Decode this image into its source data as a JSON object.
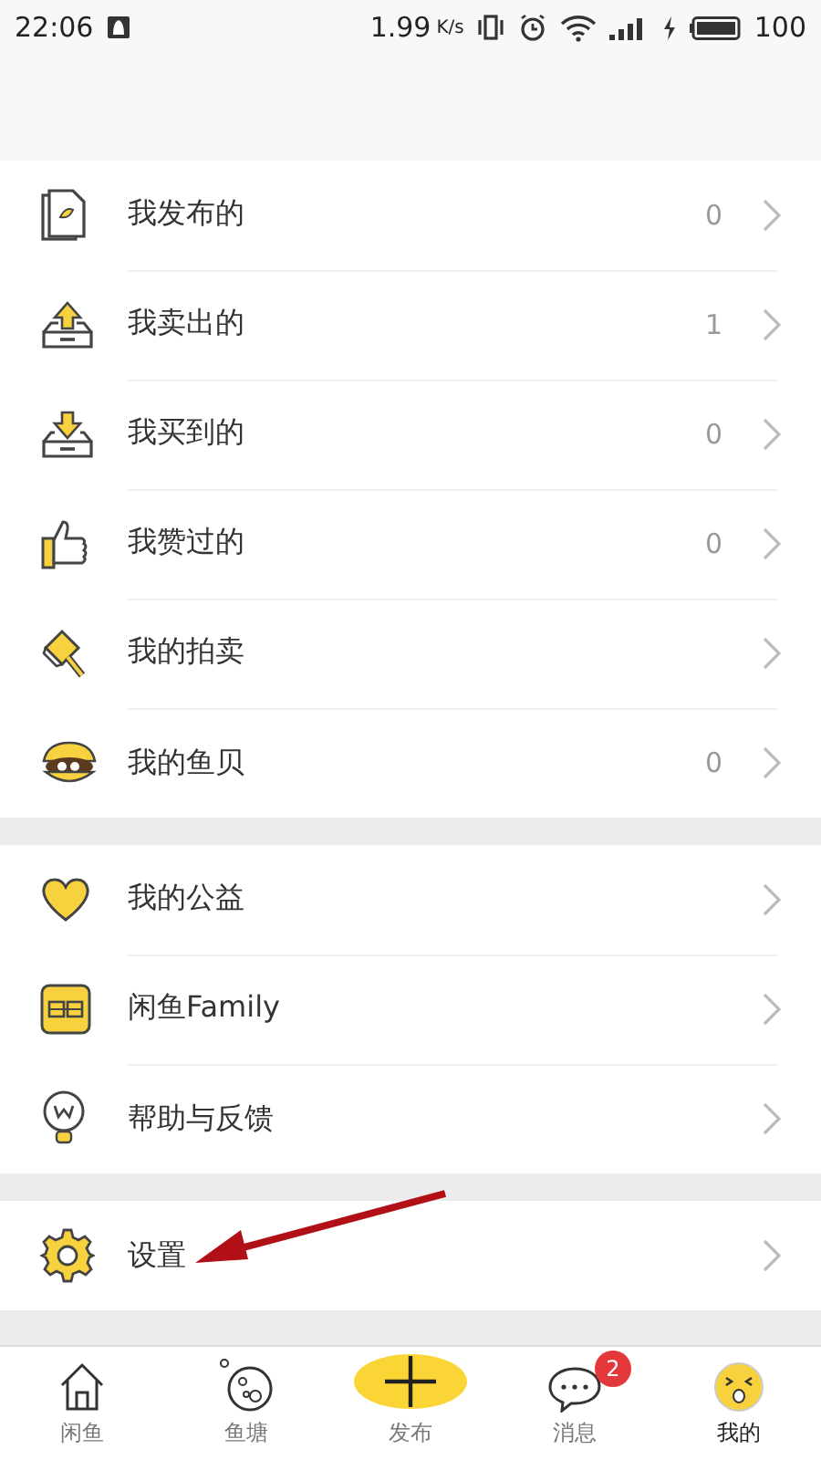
{
  "status_bar": {
    "time": "22:06",
    "speed": "1.99",
    "speed_unit": "K/s",
    "battery": "100"
  },
  "groups": [
    {
      "items": [
        {
          "label": "我发布的",
          "count": "0"
        },
        {
          "label": "我卖出的",
          "count": "1"
        },
        {
          "label": "我买到的",
          "count": "0"
        },
        {
          "label": "我赞过的",
          "count": "0"
        },
        {
          "label": "我的拍卖"
        },
        {
          "label": "我的鱼贝",
          "count": "0"
        }
      ]
    },
    {
      "items": [
        {
          "label": "我的公益"
        },
        {
          "label": "闲鱼Family"
        },
        {
          "label": "帮助与反馈"
        }
      ]
    },
    {
      "items": [
        {
          "label": "设置"
        }
      ]
    }
  ],
  "tab_bar": [
    {
      "label": "闲鱼",
      "selected": false
    },
    {
      "label": "鱼塘",
      "selected": false
    },
    {
      "label": "发布",
      "selected": false,
      "kind": "publish"
    },
    {
      "label": "消息",
      "selected": false,
      "badge": "2"
    },
    {
      "label": "我的",
      "selected": true
    }
  ]
}
